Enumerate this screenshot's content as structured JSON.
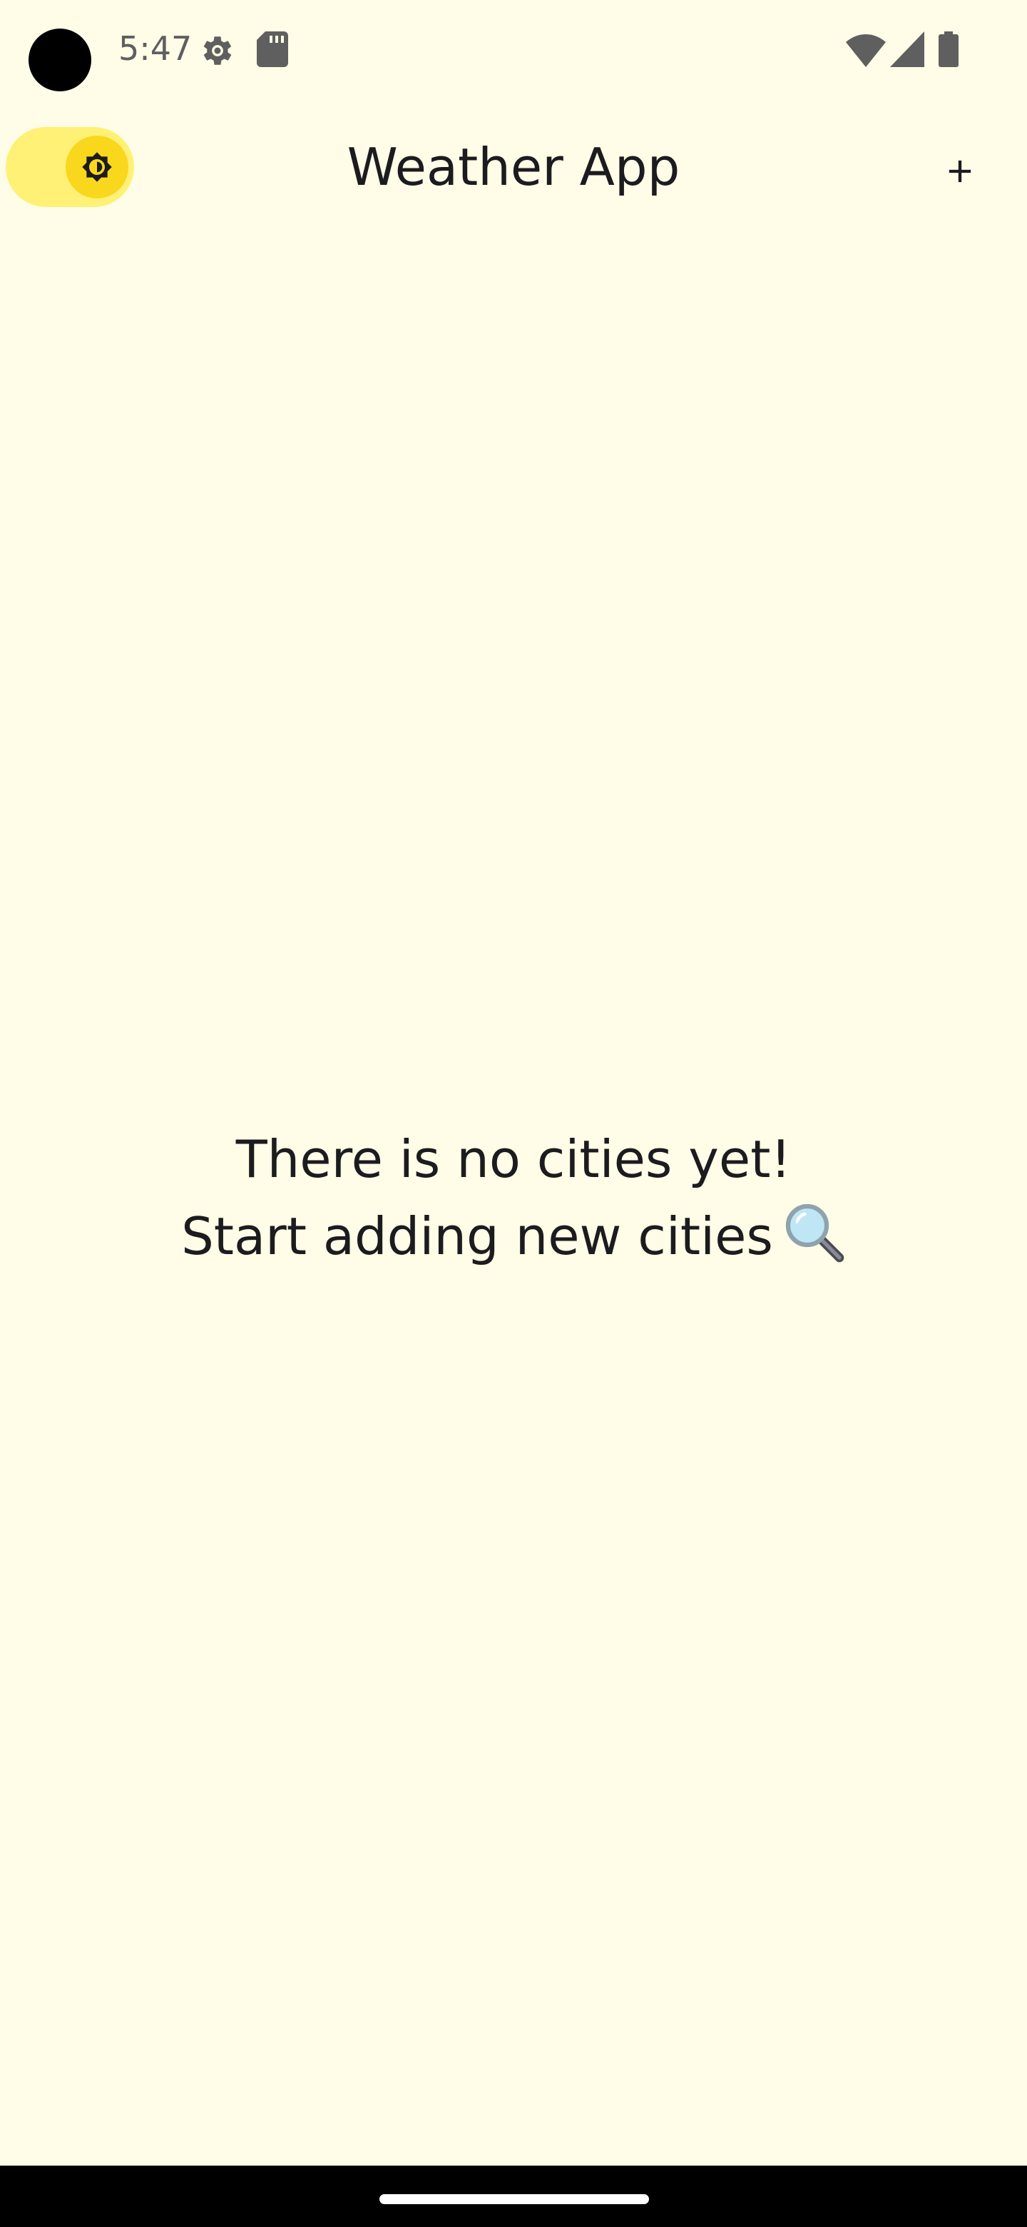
{
  "status_bar": {
    "time": "5:47",
    "icons": [
      "gear-icon",
      "sd-card-icon",
      "wifi-icon",
      "cellular-signal-icon",
      "battery-icon"
    ]
  },
  "app_bar": {
    "title": "Weather App",
    "theme_toggle_icon": "brightness-icon",
    "add_icon": "plus-icon"
  },
  "empty_state": {
    "line1": "There is no cities yet!",
    "line2": "Start adding new cities",
    "emoji_icon": "magnifying-glass-icon"
  },
  "colors": {
    "background": "#FFFDE7",
    "toggle_track": "#FFF176",
    "toggle_thumb": "#F9D71C",
    "text": "#1C1B1F",
    "status_text": "#5F5F5F"
  }
}
